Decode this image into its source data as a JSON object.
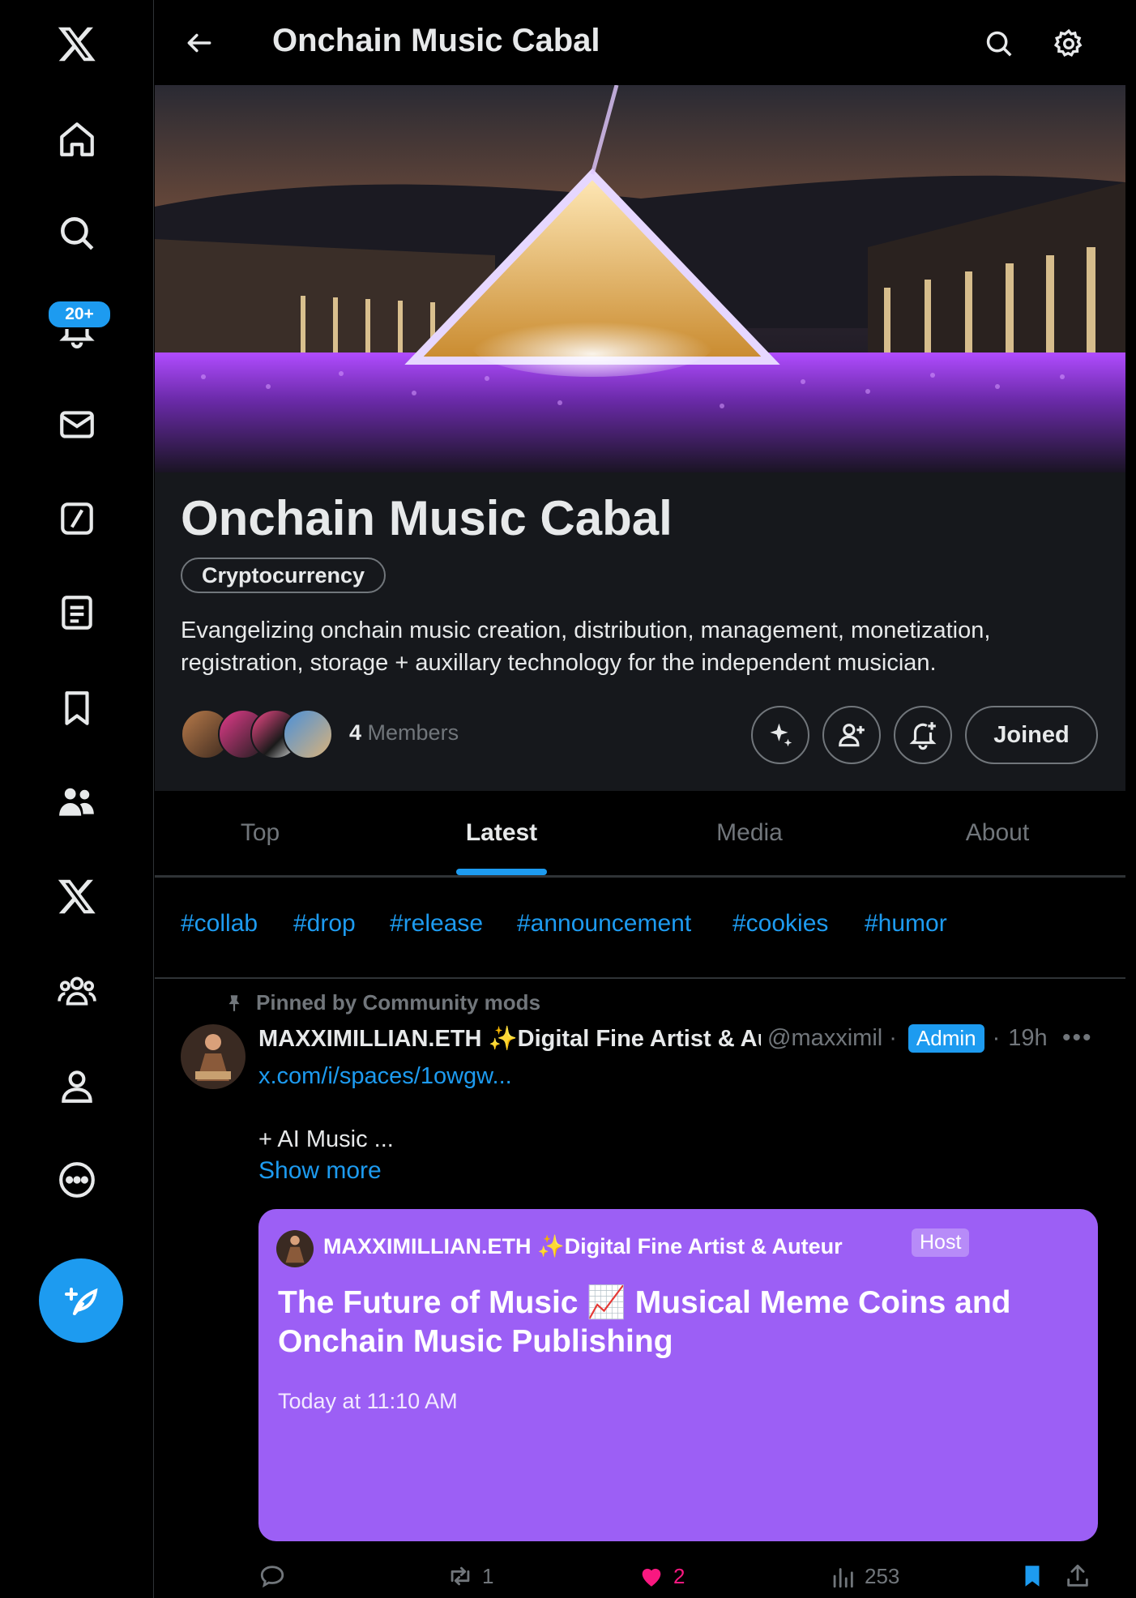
{
  "sidebar": {
    "notifications_badge": "20+",
    "items": [
      {
        "name": "x-logo-icon"
      },
      {
        "name": "home-icon"
      },
      {
        "name": "search-icon"
      },
      {
        "name": "notifications-icon"
      },
      {
        "name": "messages-icon"
      },
      {
        "name": "grok-icon"
      },
      {
        "name": "lists-icon"
      },
      {
        "name": "bookmarks-icon"
      },
      {
        "name": "communities-icon"
      },
      {
        "name": "premium-icon"
      },
      {
        "name": "verified-orgs-icon"
      },
      {
        "name": "profile-icon"
      },
      {
        "name": "more-icon"
      }
    ]
  },
  "topbar": {
    "title": "Onchain Music Cabal"
  },
  "community": {
    "title": "Onchain Music Cabal",
    "category": "Cryptocurrency",
    "description": "Evangelizing onchain music creation, distribution, management, monetization, registration, storage + auxillary technology for the independent musician.",
    "member_count": "4",
    "members_label": "Members",
    "joined_label": "Joined"
  },
  "tabs": [
    "Top",
    "Latest",
    "Media",
    "About"
  ],
  "active_tab": "Latest",
  "hashtags": [
    "#collab",
    "#drop",
    "#release",
    "#announcement",
    "#cookies",
    "#humor"
  ],
  "post": {
    "pinned_label": "Pinned by Community mods",
    "author_name": "MAXXIMILLIAN.ETH ✨Digital Fine Artist & Auteur",
    "handle": "@maxximil",
    "role_badge": "Admin",
    "time": "19h",
    "link": "x.com/i/spaces/1owgw...",
    "text": "+ AI Music ...",
    "show_more": "Show more",
    "space": {
      "host_name": "MAXXIMILLIAN.ETH ✨Digital Fine Artist & Auteur",
      "host_badge": "Host",
      "title": "The Future of Music 📈 Musical Meme Coins and Onchain Music Publishing",
      "time": "Today at 11:10 AM"
    },
    "stats": {
      "replies": "",
      "reposts": "1",
      "likes": "2",
      "views": "253"
    }
  },
  "colors": {
    "accent": "#1d9bf0",
    "space_card": "#9c5ff5",
    "like": "#f91880",
    "background": "#000000",
    "panel": "#16181c"
  }
}
